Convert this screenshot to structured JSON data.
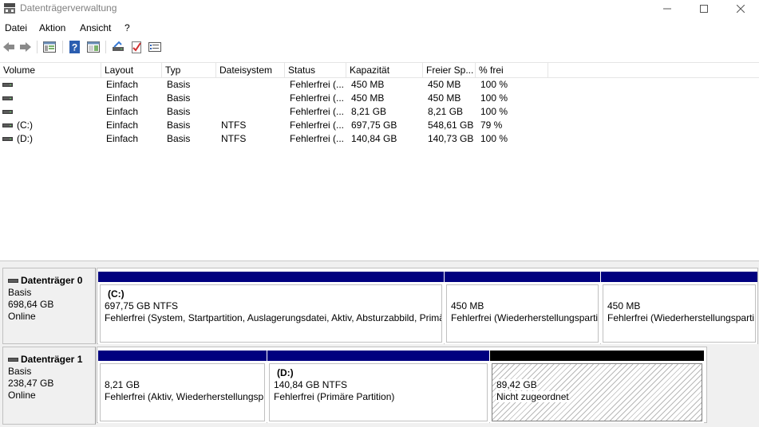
{
  "window": {
    "title": "Datenträgerverwaltung"
  },
  "menu": [
    "Datei",
    "Aktion",
    "Ansicht",
    "?"
  ],
  "toolbar": [
    "back-icon",
    "forward-icon",
    "console-tree-icon",
    "help-icon",
    "show-pane-icon",
    "connect-drive-icon",
    "check-icon",
    "properties-icon"
  ],
  "columns": [
    "Volume",
    "Layout",
    "Typ",
    "Dateisystem",
    "Status",
    "Kapazität",
    "Freier Sp...",
    "% frei"
  ],
  "volumes": [
    {
      "volume": "",
      "layout": "Einfach",
      "typ": "Basis",
      "fs": "",
      "status": "Fehlerfrei (...",
      "cap": "450 MB",
      "free": "450 MB",
      "pct": "100 %"
    },
    {
      "volume": "",
      "layout": "Einfach",
      "typ": "Basis",
      "fs": "",
      "status": "Fehlerfrei (...",
      "cap": "450 MB",
      "free": "450 MB",
      "pct": "100 %"
    },
    {
      "volume": "",
      "layout": "Einfach",
      "typ": "Basis",
      "fs": "",
      "status": "Fehlerfrei (...",
      "cap": "8,21 GB",
      "free": "8,21 GB",
      "pct": "100 %"
    },
    {
      "volume": "(C:)",
      "layout": "Einfach",
      "typ": "Basis",
      "fs": "NTFS",
      "status": "Fehlerfrei (...",
      "cap": "697,75 GB",
      "free": "548,61 GB",
      "pct": "79 %"
    },
    {
      "volume": "(D:)",
      "layout": "Einfach",
      "typ": "Basis",
      "fs": "NTFS",
      "status": "Fehlerfrei (...",
      "cap": "140,84 GB",
      "free": "140,73 GB",
      "pct": "100 %"
    }
  ],
  "disks": [
    {
      "name": "Datenträger 0",
      "type": "Basis",
      "size": "698,64 GB",
      "state": "Online",
      "partitions": [
        {
          "name": "(C:)",
          "line1": "697,75 GB NTFS",
          "line2": "Fehlerfrei (System, Startpartition, Auslagerungsdatei, Aktiv, Absturzabbild, Primä"
        },
        {
          "name": "",
          "line1": "450 MB",
          "line2": "Fehlerfrei (Wiederherstellungsparti"
        },
        {
          "name": "",
          "line1": "450 MB",
          "line2": "Fehlerfrei (Wiederherstellungsparti"
        }
      ]
    },
    {
      "name": "Datenträger 1",
      "type": "Basis",
      "size": "238,47 GB",
      "state": "Online",
      "partitions": [
        {
          "name": "",
          "line1": "8,21 GB",
          "line2": "Fehlerfrei (Aktiv, Wiederherstellungsp"
        },
        {
          "name": "(D:)",
          "line1": "140,84 GB NTFS",
          "line2": "Fehlerfrei (Primäre Partition)"
        },
        {
          "name": "",
          "line1": "89,42 GB",
          "line2": "Nicht zugeordnet"
        }
      ]
    }
  ],
  "colors": {
    "primary_partition_bar": "#00007f",
    "unallocated_bar": "#000000"
  }
}
